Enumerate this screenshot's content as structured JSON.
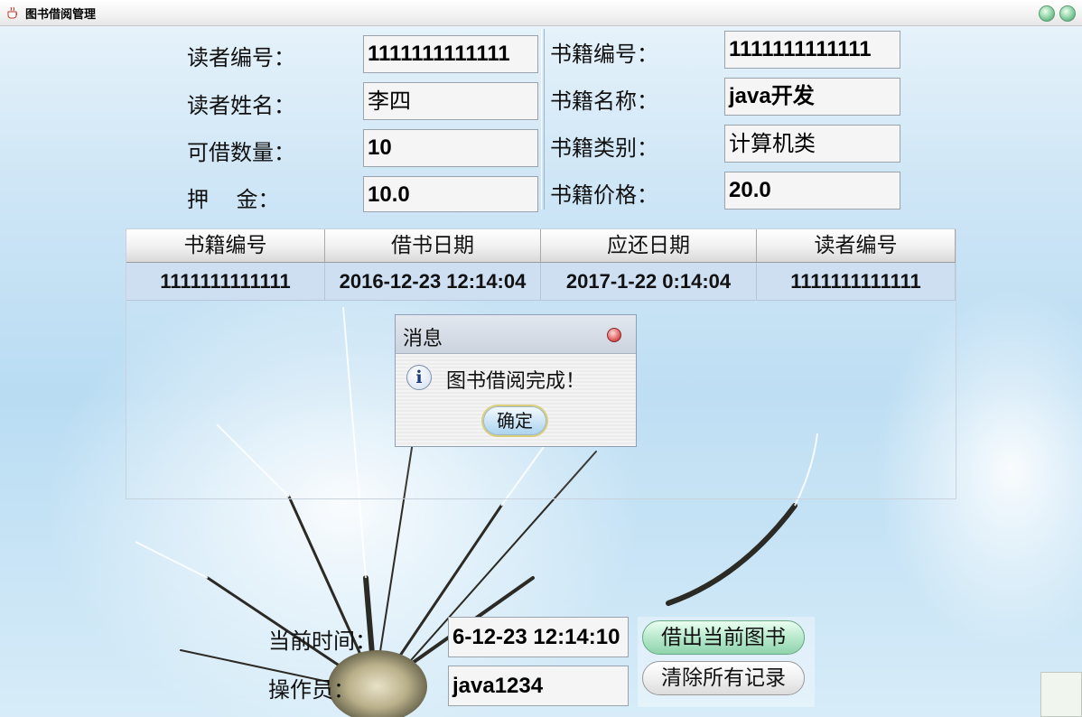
{
  "window": {
    "title": "图书借阅管理"
  },
  "reader": {
    "id_label": "读者编号：",
    "id_value": "1111111111111",
    "name_label": "读者姓名：",
    "name_value": "李四",
    "quota_label": "可借数量：",
    "quota_value": "10",
    "deposit_label": "押    金：",
    "deposit_value": "10.0"
  },
  "book": {
    "id_label": "书籍编号：",
    "id_value": "1111111111111",
    "name_label": "书籍名称：",
    "name_value": "java开发",
    "type_label": "书籍类别：",
    "type_value": "计算机类",
    "price_label": "书籍价格：",
    "price_value": "20.0"
  },
  "table": {
    "columns": [
      "书籍编号",
      "借书日期",
      "应还日期",
      "读者编号"
    ],
    "rows": [
      [
        "1111111111111",
        "2016-12-23 12:14:04",
        "2017-1-22 0:14:04",
        "1111111111111"
      ]
    ]
  },
  "dialog": {
    "title": "消息",
    "message": "图书借阅完成！",
    "ok_label": "确定",
    "icon": "info-icon"
  },
  "footer": {
    "time_label": "当前时间：",
    "time_value": "6-12-23 12:14:10",
    "operator_label": "操作员：",
    "operator_value": "java1234",
    "borrow_button": "借出当前图书",
    "clear_button": "清除所有记录"
  }
}
